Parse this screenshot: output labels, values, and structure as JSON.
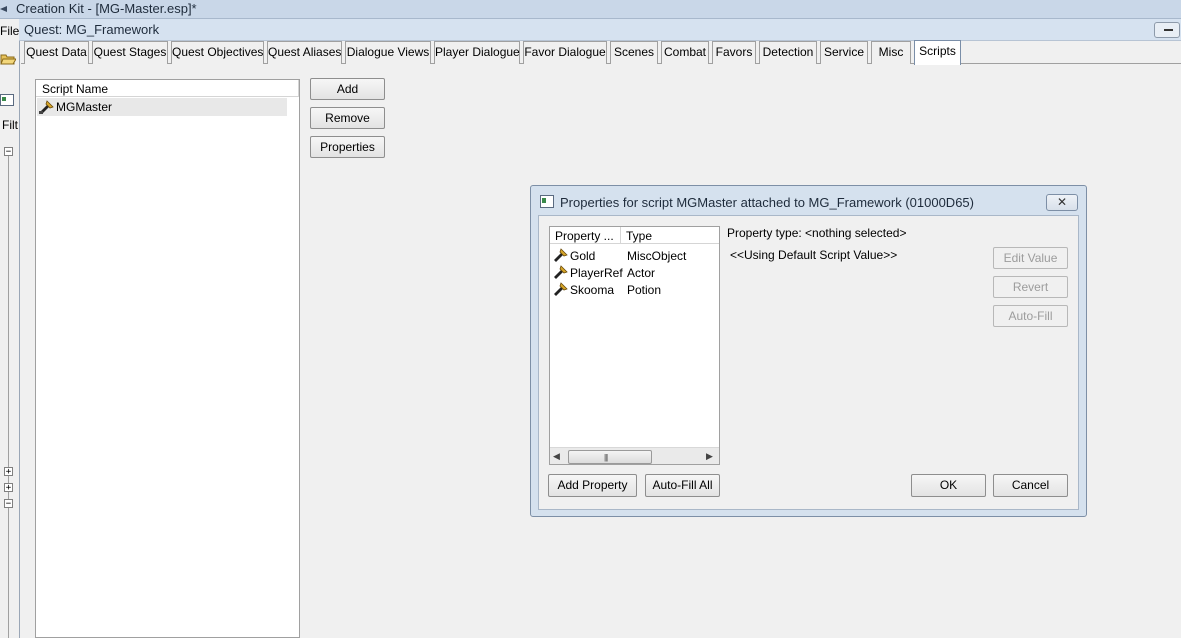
{
  "app": {
    "title": "Creation Kit - [MG-Master.esp]*",
    "file_menu": "File",
    "filter_label": "Filt"
  },
  "quest_window": {
    "title": "Quest: MG_Framework",
    "tabs": [
      {
        "label": "Quest Data"
      },
      {
        "label": "Quest Stages"
      },
      {
        "label": "Quest Objectives"
      },
      {
        "label": "Quest Aliases"
      },
      {
        "label": "Dialogue Views"
      },
      {
        "label": "Player Dialogue"
      },
      {
        "label": "Favor Dialogue"
      },
      {
        "label": "Scenes"
      },
      {
        "label": "Combat"
      },
      {
        "label": "Favors"
      },
      {
        "label": "Detection"
      },
      {
        "label": "Service"
      },
      {
        "label": "Misc"
      },
      {
        "label": "Scripts"
      }
    ],
    "active_tab": "Scripts"
  },
  "scripts": {
    "column_header": "Script Name",
    "items": [
      {
        "name": "MGMaster"
      }
    ],
    "buttons": {
      "add": "Add",
      "remove": "Remove",
      "properties": "Properties"
    }
  },
  "properties_dialog": {
    "title": "Properties for script MGMaster attached to MG_Framework (01000D65)",
    "columns": {
      "property": "Property ...",
      "type": "Type"
    },
    "properties": [
      {
        "name": "Gold",
        "type": "MiscObject"
      },
      {
        "name": "PlayerRef",
        "type": "Actor"
      },
      {
        "name": "Skooma",
        "type": "Potion"
      }
    ],
    "property_type_label": "Property type: <nothing selected>",
    "default_value_label": "<<Using Default Script Value>>",
    "buttons": {
      "edit_value": "Edit Value",
      "revert": "Revert",
      "auto_fill": "Auto-Fill",
      "add_property": "Add Property",
      "auto_fill_all": "Auto-Fill All",
      "ok": "OK",
      "cancel": "Cancel"
    },
    "close_glyph": "✕",
    "scroll_grip": "|||"
  },
  "icons": {
    "script": "script-scroll-icon",
    "property": "script-property-icon",
    "window": "window-icon",
    "folder": "open-folder-icon"
  }
}
